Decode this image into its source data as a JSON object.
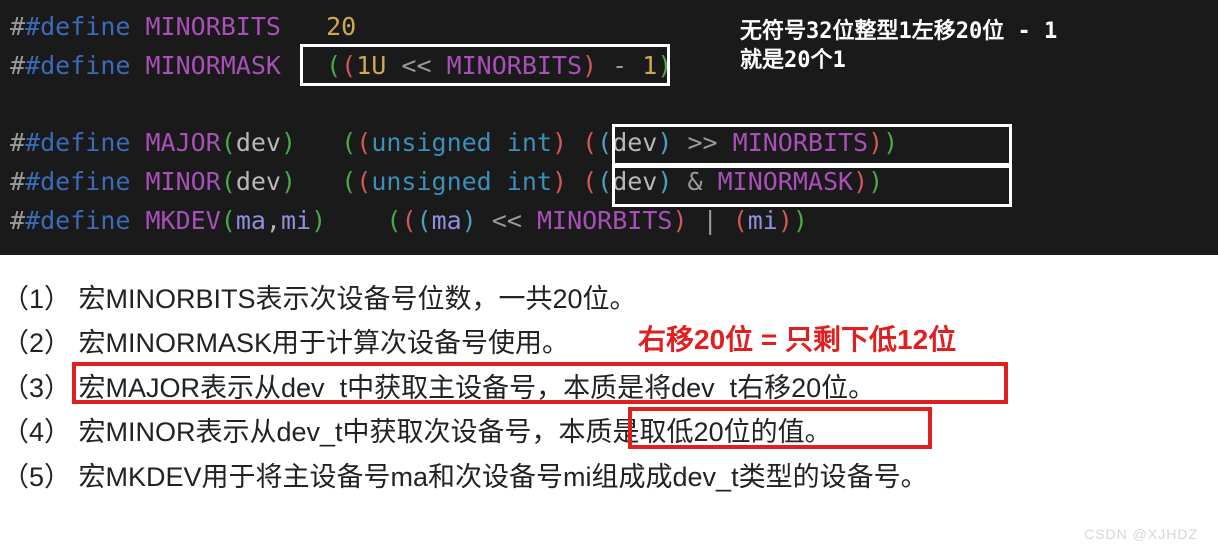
{
  "code": {
    "l1": {
      "define": "#define",
      "name": "MINORBITS",
      "val": "20"
    },
    "l2": {
      "define": "#define",
      "name": "MINORMASK",
      "expr_open": "((",
      "one": "1U",
      "shl": "<<",
      "bits": "MINORBITS",
      "close1": ")",
      "minus": "-",
      "oneNum": "1",
      "close2": ")"
    },
    "l3": {
      "define": "#define",
      "name": "MAJOR",
      "argo": "(",
      "arg": "dev",
      "argc": ")",
      "body_o": "((",
      "cast": "unsigned int",
      "cast_c": ")",
      "po": "((",
      "dev": "dev",
      "pc": ")",
      "shr": ">>",
      "bits": "MINORBITS",
      "bc": "))"
    },
    "l4": {
      "define": "#define",
      "name": "MINOR",
      "argo": "(",
      "arg": "dev",
      "argc": ")",
      "body_o": "((",
      "cast": "unsigned int",
      "cast_c": ")",
      "po": "((",
      "dev": "dev",
      "pc": ")",
      "and": "&",
      "mask": "MINORMASK",
      "bc": "))"
    },
    "l5": {
      "define": "#define",
      "name": "MKDEV",
      "argo": "(",
      "arg1": "ma",
      "comma": ",",
      "arg2": "mi",
      "argc": ")",
      "o1": "(((",
      "ma": "ma",
      "c1": ")",
      "shl": "<<",
      "bits": "MINORBITS",
      "c2": ")",
      "or": "|",
      "o3": "(",
      "mi": "mi",
      "c3": "))"
    }
  },
  "annot": {
    "top1": "无符号32位整型1左移20位 - 1",
    "top2": "就是20个1",
    "red_title": "右移20位 = 只剩下低12位"
  },
  "lines": {
    "n1": "（1） 宏MINORBITS表示次设备号位数，一共20位。",
    "n2": "（2） 宏MINORMASK用于计算次设备号使用。",
    "n3": "（3） 宏MAJOR表示从dev_t中获取主设备号，本质是将dev_t右移20位。",
    "n4": "（4） 宏MINOR表示从dev_t中获取次设备号，本质是取低20位的值。",
    "n5": "（5） 宏MKDEV用于将主设备号ma和次设备号mi组成成dev_t类型的设备号。"
  },
  "watermark": "CSDN @XJHDZ"
}
